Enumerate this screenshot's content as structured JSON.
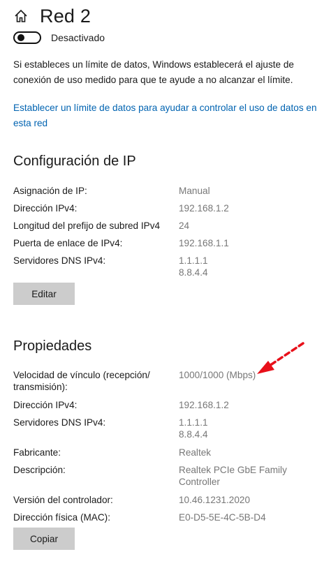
{
  "header": {
    "title": "Red 2",
    "home_icon": "home-icon"
  },
  "toggle": {
    "label": "Desactivado",
    "state": "off"
  },
  "info_text": "Si estableces un límite de datos, Windows establecerá el ajuste de conexión de uso medido para que te ayude a no alcanzar el límite.",
  "data_limit_link": "Establecer un límite de datos para ayudar a controlar el uso de datos en esta red",
  "ip_config": {
    "title": "Configuración de IP",
    "rows": [
      {
        "label": "Asignación de IP:",
        "value": "Manual"
      },
      {
        "label": "Dirección IPv4:",
        "value": "192.168.1.2"
      },
      {
        "label": "Longitud del prefijo de subred IPv4",
        "value": "24"
      },
      {
        "label": "Puerta de enlace de IPv4:",
        "value": "192.168.1.1"
      },
      {
        "label": "Servidores DNS IPv4:",
        "value": "1.1.1.1",
        "value2": "8.8.4.4"
      }
    ],
    "edit_button": "Editar"
  },
  "properties": {
    "title": "Propiedades",
    "rows": [
      {
        "label": "Velocidad de vínculo (recepción/",
        "label2": "transmisión):",
        "value": "1000/1000 (Mbps)"
      },
      {
        "label": "Dirección IPv4:",
        "value": "192.168.1.2"
      },
      {
        "label": "Servidores DNS IPv4:",
        "value": "1.1.1.1",
        "value2": "8.8.4.4"
      },
      {
        "label": "Fabricante:",
        "value": "Realtek"
      },
      {
        "label": "Descripción:",
        "value": "Realtek PCIe GbE Family",
        "value2": "Controller"
      },
      {
        "label": "Versión del controlador:",
        "value": "10.46.1231.2020"
      },
      {
        "label": "Dirección física (MAC):",
        "value": "E0-D5-5E-4C-5B-D4"
      }
    ],
    "copy_button": "Copiar"
  },
  "colors": {
    "link": "#0063b1",
    "value_text": "#777777",
    "button_bg": "#cccccc",
    "arrow": "#e8101a"
  }
}
